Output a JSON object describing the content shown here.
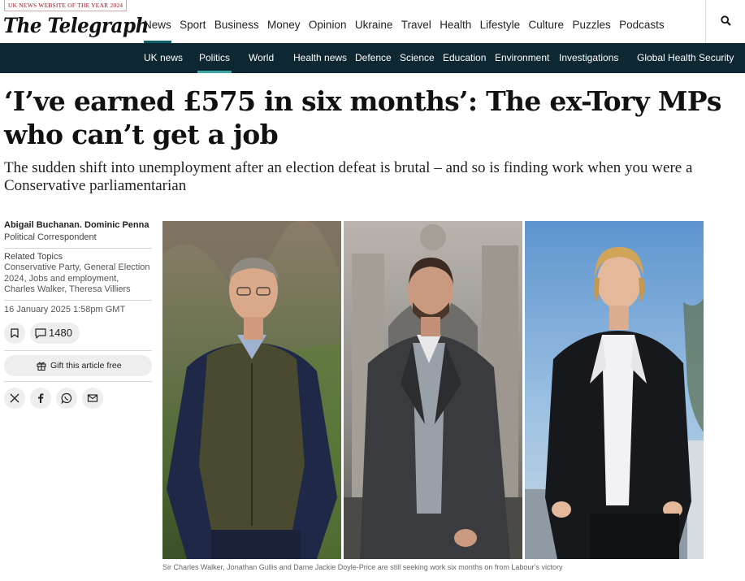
{
  "header": {
    "award": "UK NEWS WEBSITE OF THE YEAR 2024",
    "logo": "The Telegraph",
    "nav": [
      "News",
      "Sport",
      "Business",
      "Money",
      "Opinion",
      "Ukraine",
      "Travel",
      "Health",
      "Lifestyle",
      "Culture",
      "Puzzles",
      "Podcasts"
    ],
    "active_nav": "News",
    "search_icon": "search-icon"
  },
  "subnav": {
    "items": [
      "UK news",
      "Politics",
      "World",
      "Health news",
      "Defence",
      "Science",
      "Education",
      "Environment",
      "Investigations",
      "Global Health Security"
    ],
    "active": "Politics"
  },
  "article": {
    "headline": "‘I’ve earned £575 in six months’: The ex-Tory MPs who can’t get a job",
    "standfirst": "The sudden shift into unemployment after an election defeat is brutal – and so is finding work when you were a Conservative parliamentarian",
    "authors": "Abigail Buchanan.  Dominic Penna",
    "role": "Political Correspondent",
    "related_title": "Related Topics",
    "related_topics": "Conservative Party, General Election 2024, Jobs and employment, Charles Walker, Theresa Villiers",
    "date": "16 January 2025 1:58pm GMT",
    "comment_count": "1480",
    "gift_label": "Gift this article free",
    "share_icons": [
      "x-icon",
      "facebook-icon",
      "whatsapp-icon",
      "email-icon"
    ],
    "caption": "Sir Charles Walker, Jonathan Gullis and Dame Jackie Doyle-Price are still seeking work six months on from Labour’s victory"
  },
  "colors": {
    "subnav_bg": "#0d2733",
    "active_underline": "#0e5f66",
    "award_red": "#a0101b"
  }
}
